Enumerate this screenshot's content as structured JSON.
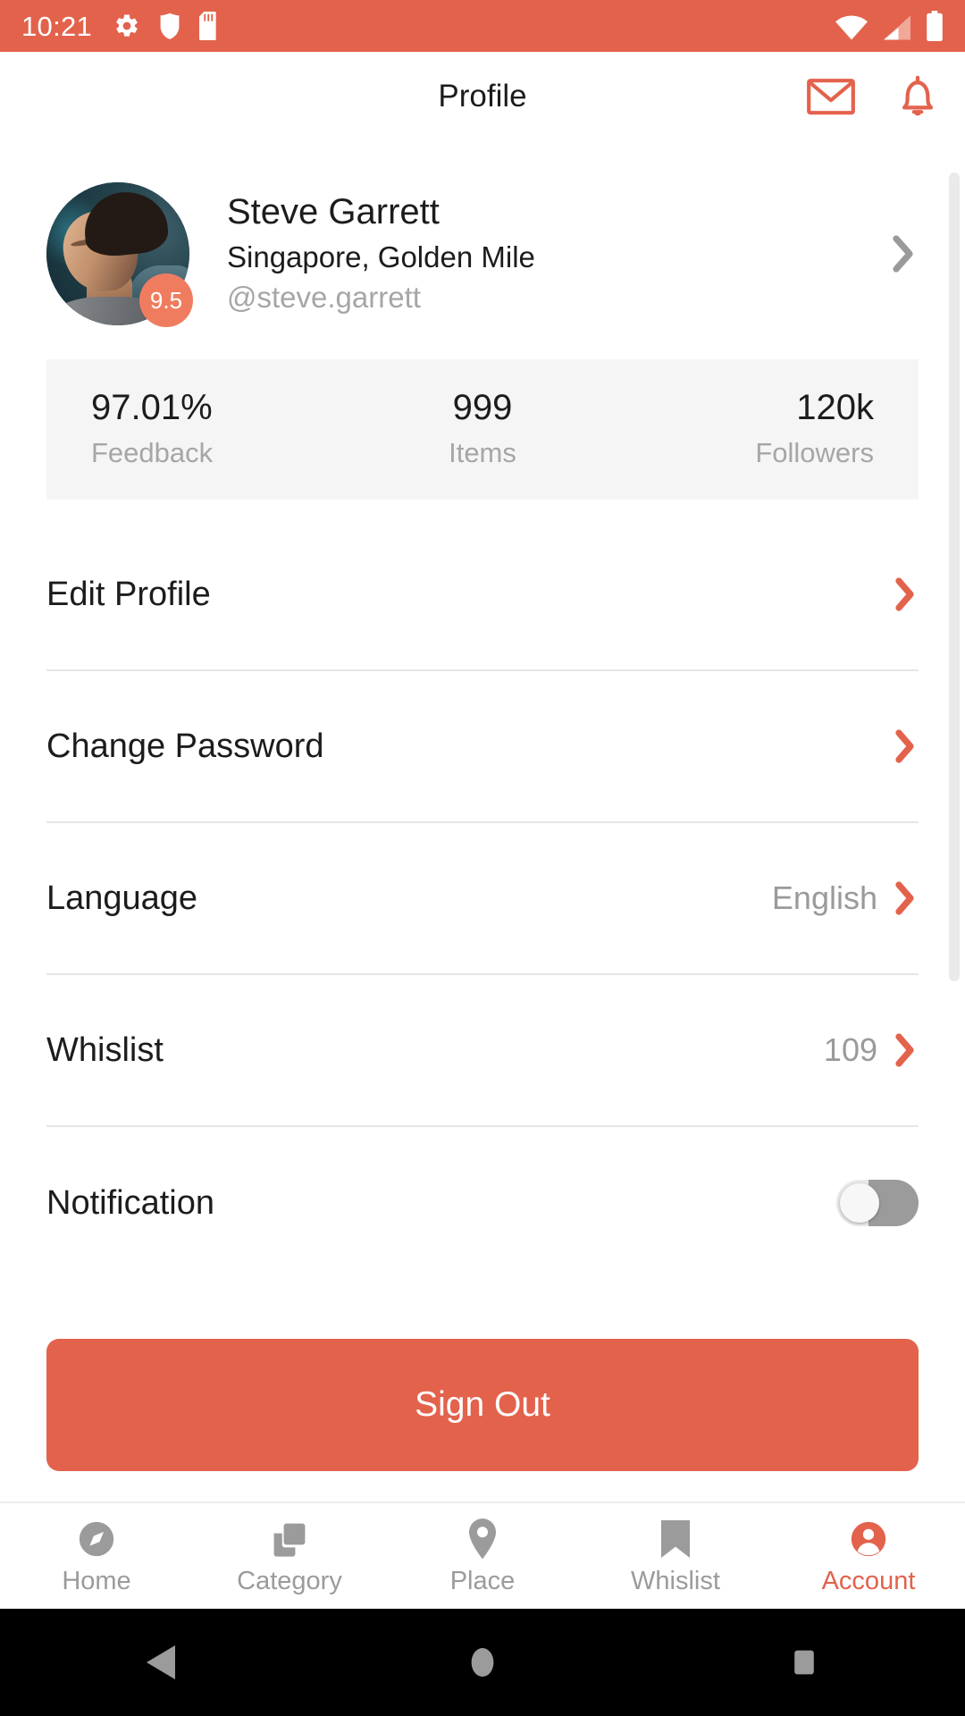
{
  "status_bar": {
    "time": "10:21",
    "left_icons": [
      "gear-icon",
      "shield-icon",
      "sd-card-icon"
    ],
    "right_icons": [
      "wifi-icon",
      "cellular-signal-icon",
      "battery-icon"
    ],
    "background_color": "#E3624C"
  },
  "app_bar": {
    "title": "Profile",
    "actions": [
      {
        "name": "mail-icon"
      },
      {
        "name": "bell-icon"
      }
    ]
  },
  "profile": {
    "name": "Steve Garrett",
    "location": "Singapore, Golden Mile",
    "handle": "@steve.garrett",
    "rating_badge": "9.5",
    "avatar_alt": "user-avatar"
  },
  "stats": [
    {
      "value": "97.01%",
      "label": "Feedback"
    },
    {
      "value": "999",
      "label": "Items"
    },
    {
      "value": "120k",
      "label": "Followers"
    }
  ],
  "menu": [
    {
      "label": "Edit Profile",
      "value": "",
      "control": "chevron"
    },
    {
      "label": "Change Password",
      "value": "",
      "control": "chevron"
    },
    {
      "label": "Language",
      "value": "English",
      "control": "chevron"
    },
    {
      "label": "Whislist",
      "value": "109",
      "control": "chevron"
    },
    {
      "label": "Notification",
      "value": "",
      "control": "toggle"
    }
  ],
  "sign_out": {
    "label": "Sign Out"
  },
  "bottom_nav": {
    "items": [
      {
        "label": "Home",
        "icon": "compass-icon",
        "active": false
      },
      {
        "label": "Category",
        "icon": "layers-icon",
        "active": false
      },
      {
        "label": "Place",
        "icon": "map-pin-icon",
        "active": false
      },
      {
        "label": "Whislist",
        "icon": "bookmark-icon",
        "active": false
      },
      {
        "label": "Account",
        "icon": "account-circle-icon",
        "active": true
      }
    ]
  },
  "android_nav": {
    "back": "back-triangle-icon",
    "home": "home-circle-icon",
    "recents": "recents-square-icon"
  },
  "colors": {
    "accent": "#E3624C",
    "badge": "#F07C5F",
    "muted_text": "#a6a6a6",
    "divider": "#e6e6e6",
    "stats_bg": "#f5f5f5"
  }
}
